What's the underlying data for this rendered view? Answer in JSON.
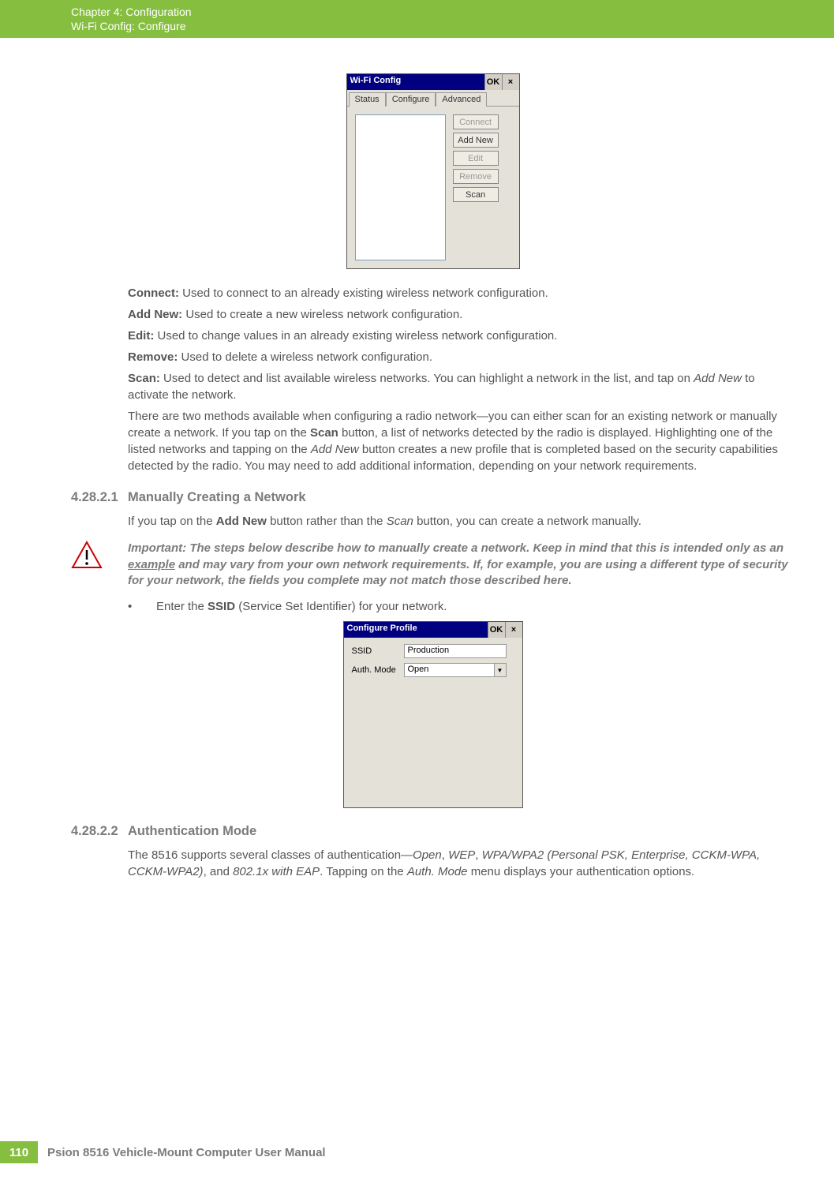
{
  "header": {
    "chapter": "Chapter 4:  Configuration",
    "sub": "Wi-Fi Config: Configure"
  },
  "fig1": {
    "title": "Wi-Fi Config",
    "ok": "OK",
    "close": "×",
    "tabs": {
      "status": "Status",
      "configure": "Configure",
      "advanced": "Advanced"
    },
    "buttons": {
      "connect": "Connect",
      "addnew": "Add New",
      "edit": "Edit",
      "remove": "Remove",
      "scan": "Scan"
    }
  },
  "defs": {
    "connect_l": "Connect:",
    "connect_t": " Used to connect to an already existing wireless network configuration.",
    "addnew_l": "Add New:",
    "addnew_t": " Used to create a new wireless network configuration.",
    "edit_l": "Edit:",
    "edit_t": " Used to change values in an already existing wireless network configuration.",
    "remove_l": "Remove:",
    "remove_t": " Used to delete a wireless network configuration.",
    "scan_l": "Scan:",
    "scan_t1": " Used to detect and list available wireless networks. You can highlight a network in the list, and tap on ",
    "scan_i": "Add New",
    "scan_t2": " to activate the network."
  },
  "para1": {
    "p1": "There are two methods available when configuring a radio network—you can either scan for an existing network or manually create a network. If you tap on the ",
    "b1": "Scan",
    "p2": " button, a list of networks detected by the radio is displayed. Highlighting one of the listed networks and tapping on the ",
    "i1": "Add New",
    "p3": " button creates a new profile that is completed based on the security capabilities detected by the radio. You may need to add additional information, depending on your network requirements."
  },
  "sec1": {
    "num": "4.28.2.1",
    "title": "Manually Creating a Network",
    "p1": "If you tap on the ",
    "b1": "Add New",
    "p2": " button rather than the ",
    "i1": "Scan",
    "p3": " button, you can create a network manually."
  },
  "important": {
    "label": "Important:",
    "t1": " The steps below describe how to manually create a network. Keep in mind that this is intended only as an ",
    "u": "example",
    "t2": " and may vary from your own network requirements. If, for example, you are using a different type of security for your network, the fields you complete may not match those described here."
  },
  "bullet": {
    "p1": "Enter the ",
    "b1": "SSID",
    "p2": " (Service Set Identifier) for your network."
  },
  "fig2": {
    "title": "Configure Profile",
    "ok": "OK",
    "close": "×",
    "ssid_l": "SSID",
    "ssid_v": "Production",
    "auth_l": "Auth. Mode",
    "auth_v": "Open"
  },
  "sec2": {
    "num": "4.28.2.2",
    "title": "Authentication Mode",
    "p1": "The 8516 supports several classes of authentication—",
    "i1": "Open",
    "c1": ", ",
    "i2": "WEP",
    "c2": ", ",
    "i3": "WPA/WPA2 (Personal PSK, Enterprise, CCKM-WPA, CCKM-WPA2)",
    "c3": ", and ",
    "i4": "802.1x with EAP",
    "p2": ". Tapping on the ",
    "i5": "Auth. Mode",
    "p3": " menu displays your authentication options."
  },
  "footer": {
    "page": "110",
    "title": "Psion 8516 Vehicle-Mount Computer User Manual"
  }
}
